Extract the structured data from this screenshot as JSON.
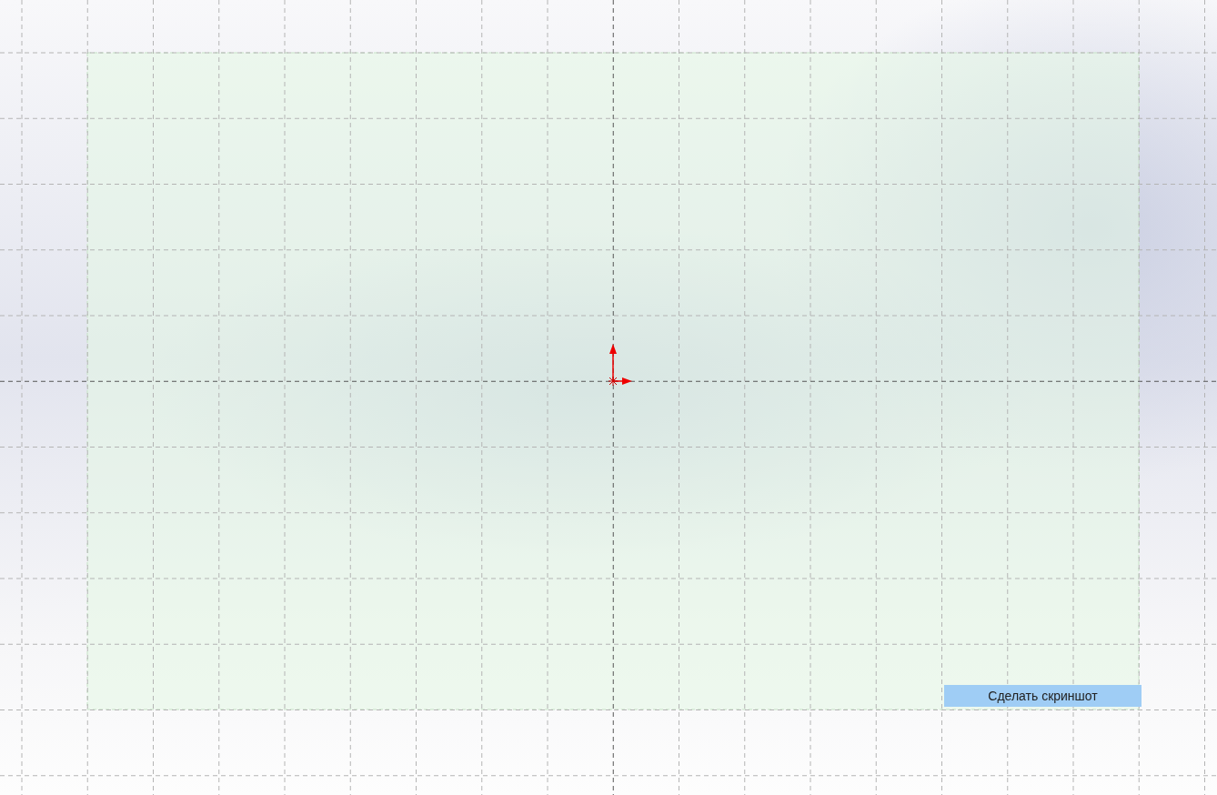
{
  "viewport": {
    "screenshot_button": {
      "label": "Сделать скриншот"
    }
  }
}
